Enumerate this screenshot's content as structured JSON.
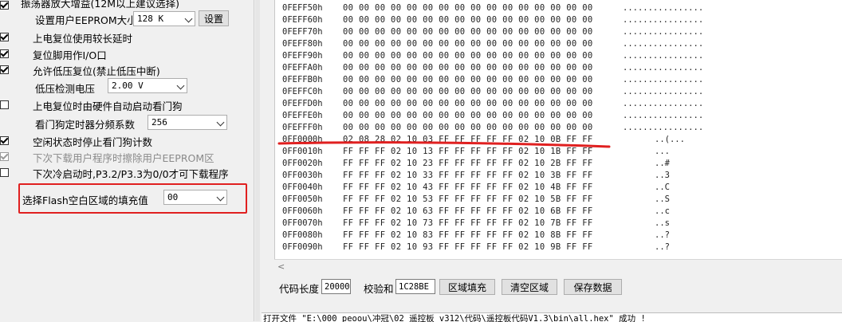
{
  "options": {
    "oscillator_gain_label": "振荡器放大增益(12M以上建议选择)",
    "eeprom_size_label": "设置用户EEPROM大小",
    "eeprom_size_value": "128  K",
    "eeprom_set_button": "设置",
    "power_on_delay": "上电复位使用较长延时",
    "reset_pin_as_io": "复位脚用作I/O口",
    "low_voltage_reset": "允许低压复位(禁止低压中断)",
    "low_voltage_label": "低压检测电压",
    "low_voltage_value": "2.00 V",
    "hw_watchdog": "上电复位时由硬件自动启动看门狗",
    "watchdog_prescaler_label": "看门狗定时器分频系数",
    "watchdog_prescaler_value": "256",
    "idle_stop_watchdog": "空闲状态时停止看门狗计数",
    "erase_eeprom_on_download": "下次下载用户程序时擦除用户EEPROM区",
    "cold_boot_download": "下次冷启动时,P3.2/P3.3为0/0才可下载程序",
    "flash_fill_label": "选择Flash空白区域的填充值",
    "flash_fill_value": "00"
  },
  "hex_rows": [
    {
      "addr": "0FEFF50h",
      "bytes": "00 00 00 00 00 00 00 00 00 00 00 00 00 00 00 00",
      "ascii": "................"
    },
    {
      "addr": "0FEFF60h",
      "bytes": "00 00 00 00 00 00 00 00 00 00 00 00 00 00 00 00",
      "ascii": "................"
    },
    {
      "addr": "0FEFF70h",
      "bytes": "00 00 00 00 00 00 00 00 00 00 00 00 00 00 00 00",
      "ascii": "................"
    },
    {
      "addr": "0FEFF80h",
      "bytes": "00 00 00 00 00 00 00 00 00 00 00 00 00 00 00 00",
      "ascii": "................"
    },
    {
      "addr": "0FEFF90h",
      "bytes": "00 00 00 00 00 00 00 00 00 00 00 00 00 00 00 00",
      "ascii": "................"
    },
    {
      "addr": "0FEFFA0h",
      "bytes": "00 00 00 00 00 00 00 00 00 00 00 00 00 00 00 00",
      "ascii": "................"
    },
    {
      "addr": "0FEFFB0h",
      "bytes": "00 00 00 00 00 00 00 00 00 00 00 00 00 00 00 00",
      "ascii": "................"
    },
    {
      "addr": "0FEFFC0h",
      "bytes": "00 00 00 00 00 00 00 00 00 00 00 00 00 00 00 00",
      "ascii": "................"
    },
    {
      "addr": "0FEFFD0h",
      "bytes": "00 00 00 00 00 00 00 00 00 00 00 00 00 00 00 00",
      "ascii": "................"
    },
    {
      "addr": "0FEFFE0h",
      "bytes": "00 00 00 00 00 00 00 00 00 00 00 00 00 00 00 00",
      "ascii": "................"
    },
    {
      "addr": "0FEFFF0h",
      "bytes": "00 00 00 00 00 00 00 00 00 00 00 00 00 00 00 00",
      "ascii": "................"
    },
    {
      "addr": "0FF0000h",
      "bytes": "02 08 28 02 10 03 FF FF FF FF FF 02 10 0B FF FF",
      "ascii": "..(..."
    },
    {
      "addr": "0FF0010h",
      "bytes": "FF FF FF 02 10 13 FF FF FF FF FF 02 10 1B FF FF",
      "ascii": "..."
    },
    {
      "addr": "0FF0020h",
      "bytes": "FF FF FF 02 10 23 FF FF FF FF FF 02 10 2B FF FF",
      "ascii": "..#"
    },
    {
      "addr": "0FF0030h",
      "bytes": "FF FF FF 02 10 33 FF FF FF FF FF 02 10 3B FF FF",
      "ascii": "..3"
    },
    {
      "addr": "0FF0040h",
      "bytes": "FF FF FF 02 10 43 FF FF FF FF FF 02 10 4B FF FF",
      "ascii": "..C"
    },
    {
      "addr": "0FF0050h",
      "bytes": "FF FF FF 02 10 53 FF FF FF FF FF 02 10 5B FF FF",
      "ascii": "..S"
    },
    {
      "addr": "0FF0060h",
      "bytes": "FF FF FF 02 10 63 FF FF FF FF FF 02 10 6B FF FF",
      "ascii": "..c"
    },
    {
      "addr": "0FF0070h",
      "bytes": "FF FF FF 02 10 73 FF FF FF FF FF 02 10 7B FF FF",
      "ascii": "..s"
    },
    {
      "addr": "0FF0080h",
      "bytes": "FF FF FF 02 10 83 FF FF FF FF FF 02 10 8B FF FF",
      "ascii": "..?"
    },
    {
      "addr": "0FF0090h",
      "bytes": "FF FF FF 02 10 93 FF FF FF FF FF 02 10 9B FF FF",
      "ascii": "..?"
    }
  ],
  "toolbar": {
    "code_length_label": "代码长度",
    "code_length_value": "20000",
    "checksum_label": "校验和",
    "checksum_value": "1C28BE",
    "fill_region_button": "区域填充",
    "clear_region_button": "清空区域",
    "save_data_button": "保存数据"
  },
  "log": {
    "text": "打开文件 \"E:\\000_peoou\\冲冠\\02_遥控板_v312\\代码\\遥控板代码V1.3\\bin\\all.hex\" 成功 !"
  },
  "colors": {
    "highlight": "#e02020"
  }
}
